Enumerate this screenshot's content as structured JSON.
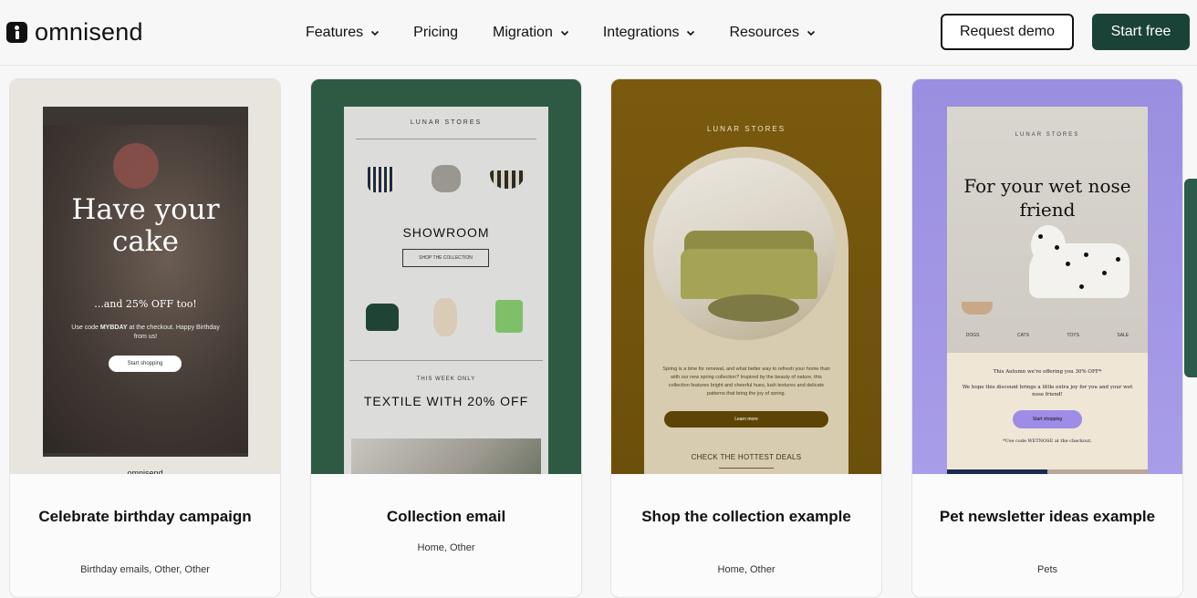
{
  "header": {
    "logo_text": "omnisend",
    "nav": [
      {
        "label": "Features",
        "has_dropdown": true
      },
      {
        "label": "Pricing",
        "has_dropdown": false
      },
      {
        "label": "Migration",
        "has_dropdown": true
      },
      {
        "label": "Integrations",
        "has_dropdown": true
      },
      {
        "label": "Resources",
        "has_dropdown": true
      }
    ],
    "request_demo_label": "Request demo",
    "start_free_label": "Start free"
  },
  "cards": [
    {
      "title": "Celebrate birthday campaign",
      "tags": "Birthday emails, Other, Other",
      "preview": {
        "headline": "Have your cake",
        "sub": "...and 25% OFF too!",
        "body_pre": "Use code ",
        "body_code": "MYBDAY",
        "body_post": " at the checkout. Happy Birthday from us!",
        "cta": "Start shopping",
        "brand": "omnisend"
      }
    },
    {
      "title": "Collection email",
      "tags": "Home, Other",
      "preview": {
        "brand": "LUNAR STORES",
        "heading": "SHOWROOM",
        "button": "SHOP THE COLLECTION",
        "kicker": "THIS WEEK ONLY",
        "offer": "TEXTILE WITH 20% OFF"
      }
    },
    {
      "title": "Shop the collection example",
      "tags": "Home, Other",
      "preview": {
        "brand": "LUNAR STORES",
        "copy": "Spring is a time for renewal, and what better way to refresh your home than with our new spring collection? Inspired by the beauty of nature, this collection features bright and cheerful hues, lush textures and delicate patterns that bring the joy of spring.",
        "cta": "Learn more",
        "footer": "CHECK THE HOTTEST DEALS"
      }
    },
    {
      "title": "Pet newsletter ideas example",
      "tags": "Pets",
      "preview": {
        "brand": "LUNAR STORES",
        "headline": "For your wet nose friend",
        "categories": [
          "DOGS",
          "CATS",
          "TOYS",
          "SALE"
        ],
        "line1": "This Autumn we're offering you 30% OFF*",
        "line2": "We hope this discount brings a little extra joy for you and your wet nose friend!",
        "cta": "Start shopping",
        "code": "*Use code WETNOSE at the checkout."
      }
    }
  ],
  "colors": {
    "brand_green": "#1b4236",
    "card2_bg": "#2e5a44",
    "card3_bg": "#7a5a0e",
    "card4_bg": "#9a8ee0"
  }
}
